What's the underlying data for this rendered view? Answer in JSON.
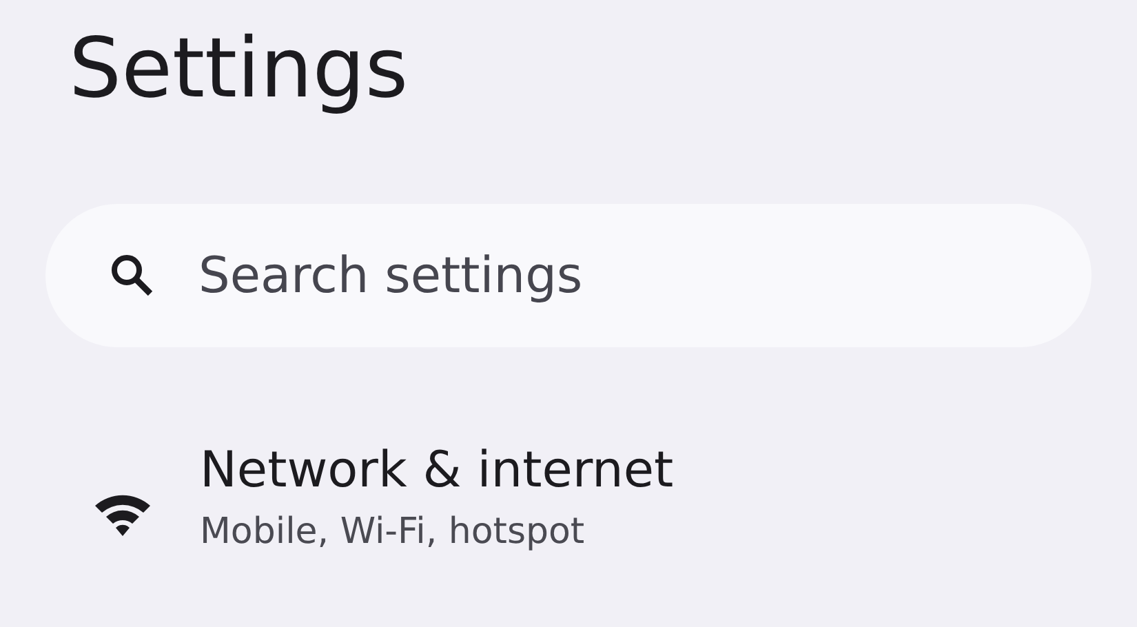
{
  "header": {
    "title": "Settings"
  },
  "search": {
    "placeholder": "Search settings"
  },
  "items": [
    {
      "kind": "wifi",
      "title": "Network & internet",
      "subtitle": "Mobile, Wi-Fi, hotspot"
    }
  ]
}
